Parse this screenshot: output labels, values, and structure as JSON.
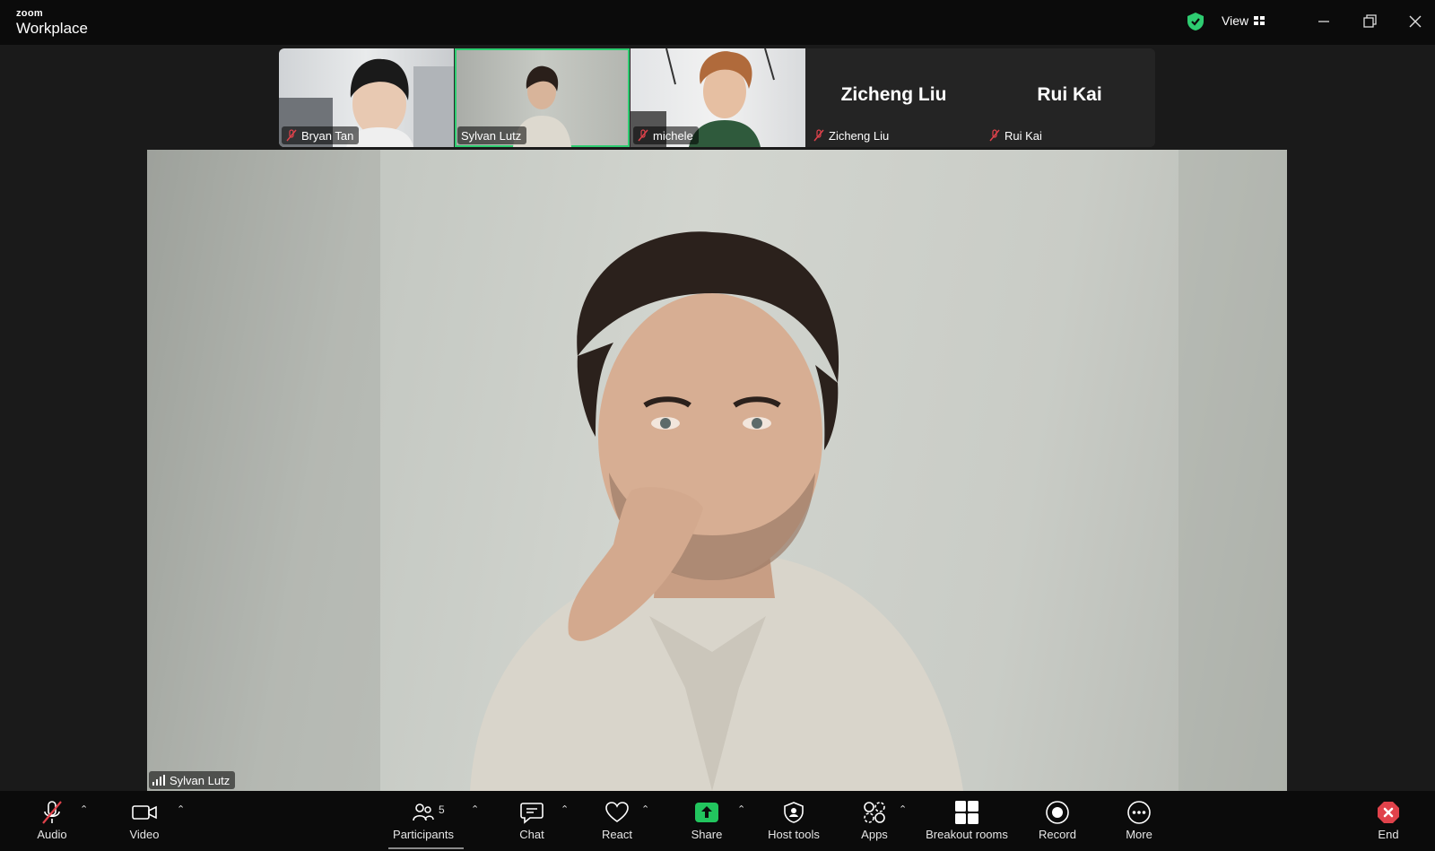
{
  "app": {
    "brand_top": "zoom",
    "brand_bottom": "Workplace",
    "view_label": "View",
    "colors": {
      "accent_green": "#2ecc71",
      "mute_red": "#e0424b",
      "share_green": "#22c55e",
      "end_red": "#e0424b"
    }
  },
  "thumbnails": [
    {
      "name": "Bryan Tan",
      "muted": true,
      "video": true
    },
    {
      "name": "Sylvan Lutz",
      "muted": false,
      "video": true,
      "active": true
    },
    {
      "name": "michele",
      "muted": true,
      "video": true
    },
    {
      "name": "Zicheng Liu",
      "muted": true,
      "video": false,
      "display_name": "Zicheng Liu"
    },
    {
      "name": "Rui Kai",
      "muted": true,
      "video": false,
      "display_name": "Rui Kai"
    }
  ],
  "main_video": {
    "speaker": "Sylvan Lutz",
    "signal_icon": "signal-bars-icon"
  },
  "toolbar": {
    "audio": "Audio",
    "video": "Video",
    "participants": "Participants",
    "participants_count": "5",
    "chat": "Chat",
    "react": "React",
    "share": "Share",
    "host_tools": "Host tools",
    "apps": "Apps",
    "breakout_rooms": "Breakout rooms",
    "record": "Record",
    "more": "More",
    "end": "End",
    "caret": "⌃"
  }
}
